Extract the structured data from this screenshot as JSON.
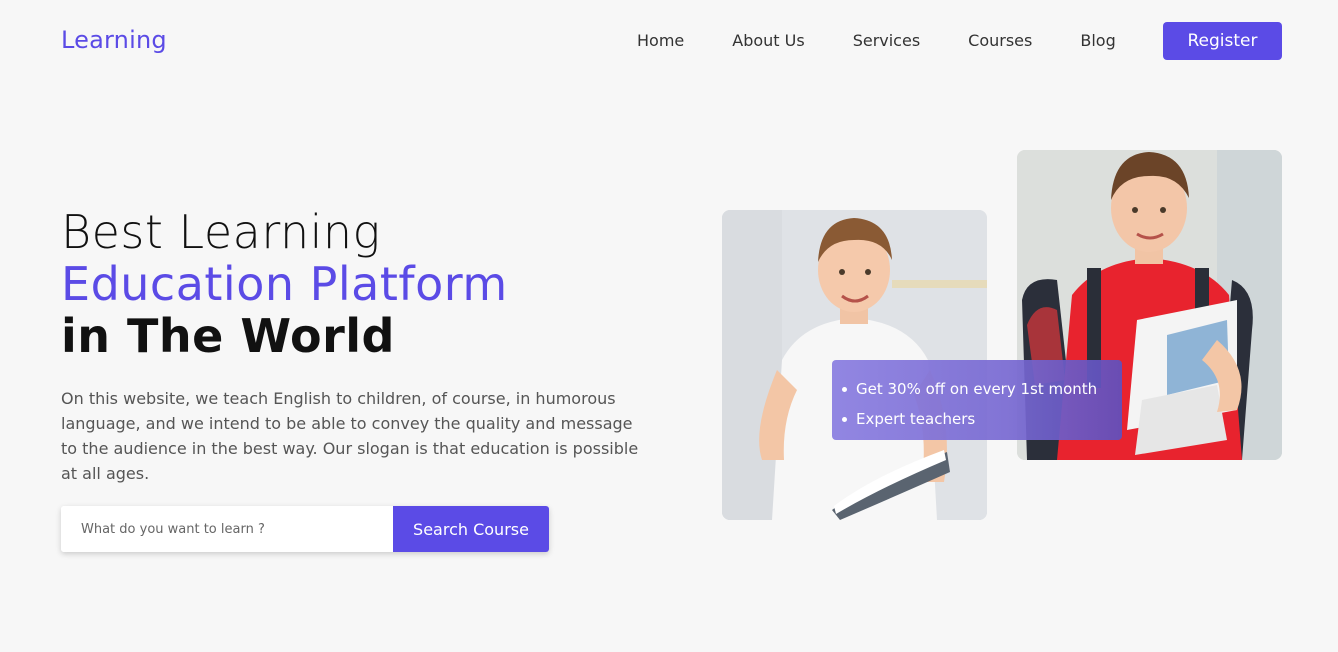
{
  "header": {
    "logo": "Learning",
    "nav": [
      "Home",
      "About Us",
      "Services",
      "Courses",
      "Blog"
    ],
    "register_label": "Register"
  },
  "hero": {
    "title_line1": "Best Learning",
    "title_line2": "Education Platform",
    "title_line3": "in The World",
    "description": "On this website, we teach English to children, of course, in humorous language, and we intend to be able to convey the quality and message to the audience in the best way. Our slogan is that education is possible at all ages.",
    "search_placeholder": "What do you want to learn ?",
    "search_button": "Search Course"
  },
  "promo": {
    "items": [
      "Get 30% off on every 1st month",
      "Expert teachers"
    ]
  },
  "colors": {
    "accent": "#5b4be6",
    "background": "#f7f7f7"
  }
}
